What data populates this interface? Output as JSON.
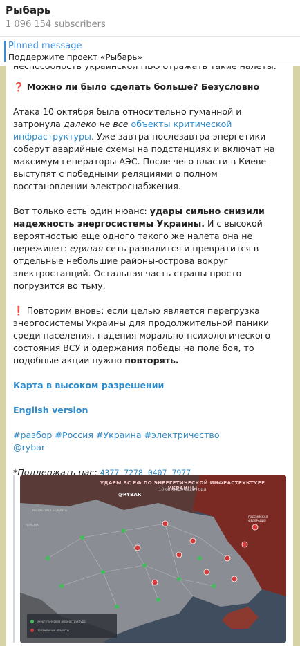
{
  "channel": {
    "title": "Рыбарь",
    "subscribers": "1 096 154 subscribers"
  },
  "pinned": {
    "label": "Pinned message",
    "text": "Поддержите проект «Рыбарь»"
  },
  "message": {
    "cut_line": "неспособность украинской ПВО отражать такие налеты.",
    "q_emoji": "❓",
    "q_text": "Можно ли было сделать больше? Безусловно",
    "p1_a": "Атака 10 октября была относительно гуманной и затронула ",
    "p1_italic": "далеко не все",
    "p1_link": "объекты критической инфраструктуры",
    "p1_b": ". Уже завтра-послезавтра энергетики соберут аварийные схемы на подстанциях и включат на максимум генераторы АЭС. После чего власти в Киеве выступят с победными реляциями о полном восстановлении электроснабжения.",
    "p2_a": "Вот только есть один нюанс: ",
    "p2_bold": "удары сильно снизили надежность энергосистемы Украины.",
    "p2_b": " И с высокой вероятностью еще одного такого же налета она не переживет: ",
    "p2_italic": "единая",
    "p2_c": " сеть развалится и превратится в отдельные небольшие районы-острова вокруг электростанций. Остальная часть страны просто погрузится во тьму.",
    "p3_emoji": "❗️",
    "p3_a": " Повторим вновь: если целью является перегрузка энергосистемы Украины для продолжительной паники среди населения, падения морально-психологического состояния ВСУ и одержания победы на поле боя, то подобные акции нужно ",
    "p3_bold": "повторять.",
    "link_map": "Карта в высоком разрешении",
    "link_english": "English version",
    "hashtags": "#разбор #Россия #Украина #электричество",
    "mention": "@rybar",
    "support_label": "*Поддержать нас:",
    "card_number": "4377 7278 0407 7977"
  },
  "map_image": {
    "title": "УДАРЫ ВС РФ ПО ЭНЕРГЕТИЧЕСКОЙ ИНФРАСТРУКТУРЕ УКРАИНЫ",
    "date": "10 октября 2022 года",
    "brand": "@RYBAR",
    "label_belarus": "РЕСПУБЛИКА БЕЛАРУСЬ",
    "label_russia": "РОССИЙСКАЯ ФЕДЕРАЦИЯ",
    "label_poland": "ПОЛЬША",
    "legend_1": "Энергетическая инфраструктура",
    "legend_2": "Поражённые объекты",
    "colors": {
      "ukraine": "#8a8d93",
      "russia": "#7a2a23",
      "belarus": "#5a3a36",
      "sea": "#3f4d5e",
      "hit": "#d23a3a",
      "station": "#3fbf5a"
    }
  }
}
